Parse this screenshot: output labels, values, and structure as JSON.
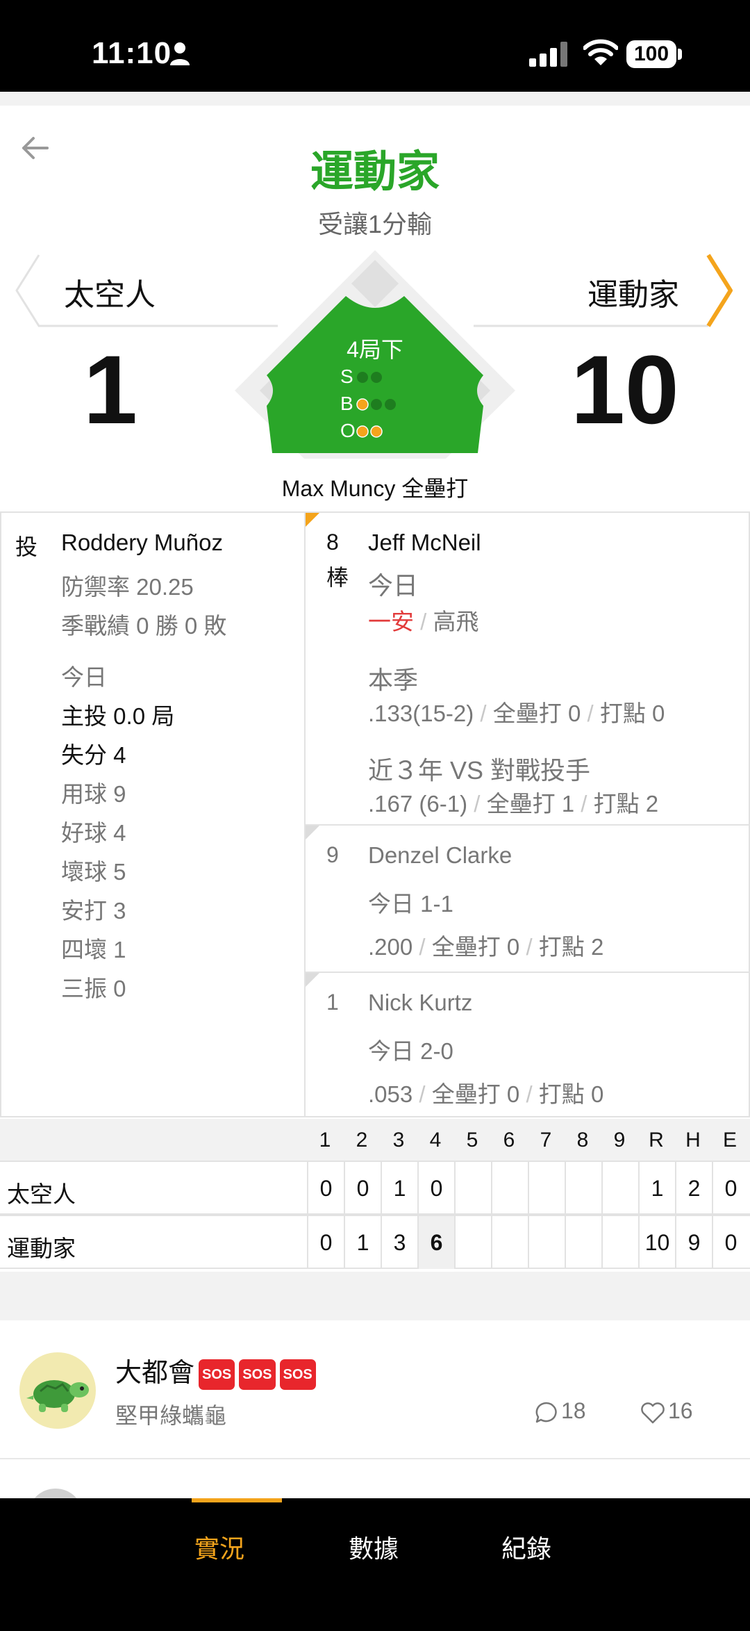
{
  "status_bar": {
    "time": "11:10",
    "battery": "100"
  },
  "header": {
    "winner": "運動家",
    "result": "受讓1分輸"
  },
  "teams": {
    "away": {
      "name": "太空人",
      "score": "1"
    },
    "home": {
      "name": "運動家",
      "score": "10"
    }
  },
  "field": {
    "inning": "4局下",
    "labels": {
      "s": "S",
      "b": "B",
      "o": "O"
    },
    "strikes": 0,
    "balls": 1,
    "outs": 2,
    "last_play": "Max Muncy 全壘打"
  },
  "pitcher": {
    "tag": "投",
    "name": "Roddery Muñoz",
    "era": "防禦率 20.25",
    "record": "季戰績 0 勝 0 敗",
    "today_label": "今日",
    "innings": "主投 0.0 局",
    "runs": "失分 4",
    "pitches": "用球 9",
    "strikes": "好球 4",
    "balls": "壞球 5",
    "hits": "安打 3",
    "walks": "四壞 1",
    "strikeouts": "三振 0"
  },
  "current_batter": {
    "order": "8",
    "order_suffix": "棒",
    "name": "Jeff McNeil",
    "today_label": "今日",
    "today_hit": "一安",
    "today_other": "高飛",
    "season_label": "本季",
    "season_avg": ".133(15-2)",
    "season_hr": "全壘打 0",
    "season_rbi": "打點 0",
    "vs_label": "近３年 VS 對戰投手",
    "vs_avg": ".167 (6-1)",
    "vs_hr": "全壘打 1",
    "vs_rbi": "打點 2"
  },
  "next_batters": [
    {
      "order": "9",
      "name": "Denzel Clarke",
      "today": "今日 1-1",
      "avg": ".200",
      "hr": "全壘打 0",
      "rbi": "打點 2"
    },
    {
      "order": "1",
      "name": "Nick Kurtz",
      "today": "今日 2-0",
      "avg": ".053",
      "hr": "全壘打 0",
      "rbi": "打點 0"
    }
  ],
  "line_score": {
    "headers": [
      "1",
      "2",
      "3",
      "4",
      "5",
      "6",
      "7",
      "8",
      "9",
      "R",
      "H",
      "E"
    ],
    "rows": [
      {
        "team": "太空人",
        "cells": [
          "0",
          "0",
          "1",
          "0",
          "",
          "",
          "",
          "",
          "",
          "1",
          "2",
          "0"
        ]
      },
      {
        "team": "運動家",
        "cells": [
          "0",
          "1",
          "3",
          "6",
          "",
          "",
          "",
          "",
          "",
          "10",
          "9",
          "0"
        ]
      }
    ]
  },
  "comment": {
    "user": "大都會",
    "badges": [
      "SOS",
      "SOS",
      "SOS"
    ],
    "subtitle": "堅甲綠蠵龜",
    "replies": "18",
    "likes": "16"
  },
  "bottom_nav": {
    "items": [
      "實況",
      "數據",
      "紀錄"
    ],
    "active": 0
  },
  "colors": {
    "accent": "#f4a41c",
    "field_green": "#2aa629",
    "hit_red": "#e23b3b"
  }
}
